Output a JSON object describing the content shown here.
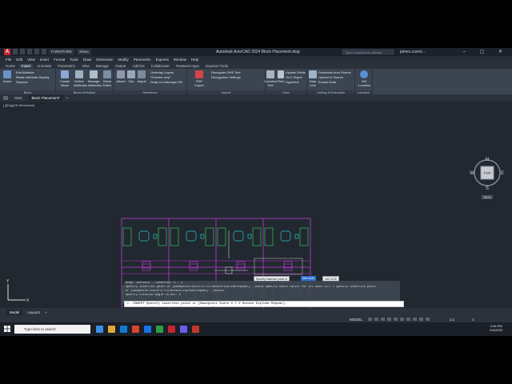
{
  "window": {
    "title": "Autodesk AutoCAD 2024  Block Placement.dwg",
    "search_placeholder": "Type a keyword or phrase",
    "user": "james.cuevo...",
    "workspace": "FURNITURE",
    "share_label": "Share",
    "logo_letter": "A"
  },
  "menu": [
    "File",
    "Edit",
    "View",
    "Insert",
    "Format",
    "Tools",
    "Draw",
    "Dimension",
    "Modify",
    "Parametric",
    "Express",
    "Window",
    "Help"
  ],
  "ribbon_tabs": [
    "Home",
    "Insert",
    "Annotate",
    "Parametric",
    "View",
    "Manage",
    "Output",
    "Add-ins",
    "Collaborate",
    "Featured Apps",
    "Express Tools"
  ],
  "active_ribbon_tab": "Insert",
  "ribbon": {
    "block": {
      "insert": "Insert",
      "edit_attribute": "Edit Attribute",
      "retain_display": "Retain Attribute Display",
      "replace": "Replace",
      "title": "Block"
    },
    "block_definition": {
      "create": "Create Block",
      "define": "Define Attributes",
      "manage": "Manage Attributes",
      "editor": "Block Editor",
      "title": "Block Definition"
    },
    "reference": {
      "attach": "Attach",
      "clip": "Clip",
      "adjust": "Adjust",
      "underlay_layers": "Underlay Layers",
      "frames_vary": "*Frames vary*",
      "snap_underlays": "Snap to Underlays ON",
      "title": "Reference"
    },
    "import": {
      "pdf_import": "PDF Import",
      "recognize_shx": "Recognize SHX Text",
      "recognition_settings": "Recognition Settings",
      "title": "Import"
    },
    "data": {
      "combine_text": "Combine Text",
      "field": "Field",
      "update_fields": "Update Fields",
      "ole_object": "OLE Object",
      "hyperlink": "Hyperlink",
      "title": "Data"
    },
    "linking": {
      "data_link": "Data Link",
      "download_source": "Download from Source",
      "upload_source": "Upload to Source",
      "extract_data": "Extract Data",
      "title": "Linking & Extraction"
    },
    "location": {
      "set_location": "Set Location",
      "title": "Location"
    }
  },
  "doc_tabs": [
    "Start",
    "Block Placement*"
  ],
  "active_doc_tab": "Block Placement*",
  "viewport_label": "[-][Top][2D Wireframe]",
  "viewcube": {
    "n": "N",
    "s": "S",
    "e": "E",
    "w": "W",
    "top": "TOP",
    "wcs": "WCS"
  },
  "drawing": {
    "colors": {
      "wall": "#c23bd4",
      "desk": "#3fbf5a",
      "chair": "#27c3c9",
      "background": "#212830"
    }
  },
  "cursor_prompt": "Specify insertion point or",
  "cursor_x": "354.0442",
  "cursor_y": "162.1130",
  "command_history": [
    "Snap: Inhibits - Converted:  0 , 1",
    "Specify insertion point or [Basepoint/Scale/X/Y/Z/Rotate/Explode/Repeat]: _Scale Specify scale factor for XYZ axes <1>: 1 Specify insertion point",
    "or [Basepoint/Scale/X/Y/Z/Rotate/Explode/Repeat]: _Rotate",
    "Specify rotation angle <0.00>: 0"
  ],
  "command_line": "▸ -INSERT Specify insertion point or [Basepoint Scale X Y Z Rotate Explode Repeat]:",
  "layout_tabs": [
    "Model",
    "Layout1"
  ],
  "active_layout_tab": "Model",
  "status": {
    "model": "MODEL",
    "scale": "1:1"
  },
  "taskbar": {
    "search": "Type here to search",
    "time": "2:09 PM",
    "date": "5/4/2023"
  }
}
